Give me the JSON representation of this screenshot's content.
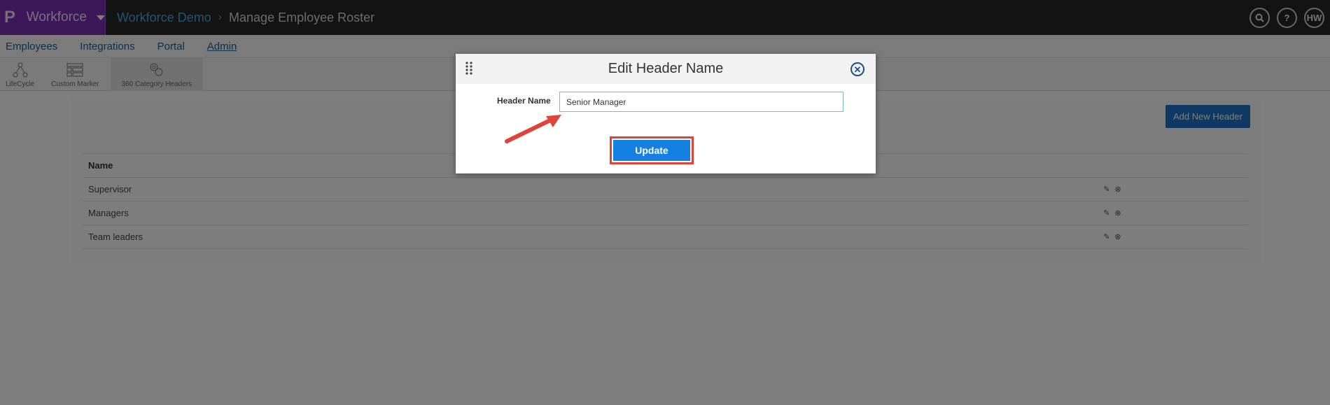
{
  "app": {
    "brand_logo": "P",
    "brand_name": "Workforce",
    "breadcrumb_link": "Workforce Demo",
    "breadcrumb_sep": "›",
    "breadcrumb_current": "Manage Employee Roster",
    "user_initials": "HW",
    "search_glyph": "🔍",
    "help_glyph": "?"
  },
  "nav": {
    "items": [
      {
        "label": "Employees"
      },
      {
        "label": "Integrations"
      },
      {
        "label": "Portal"
      },
      {
        "label": "Admin"
      }
    ]
  },
  "subnav": {
    "items": [
      {
        "label": "LifeCycle",
        "icon": "lifecycle-icon"
      },
      {
        "label": "Custom Marker",
        "icon": "custom-marker-icon"
      },
      {
        "label": "360 Category Headers",
        "icon": "category-headers-icon"
      }
    ]
  },
  "main": {
    "add_button": "Add New Header",
    "table": {
      "header": "Name",
      "rows": [
        {
          "name": "Supervisor"
        },
        {
          "name": "Managers"
        },
        {
          "name": "Team leaders"
        }
      ]
    }
  },
  "modal": {
    "title": "Edit Header Name",
    "close_glyph": "✕",
    "field_label": "Header Name",
    "field_value": "Senior Manager",
    "update_button": "Update"
  },
  "colors": {
    "brand_purple": "#7b2fb5",
    "primary_blue": "#1480e2",
    "highlight_red": "#e0433a"
  }
}
